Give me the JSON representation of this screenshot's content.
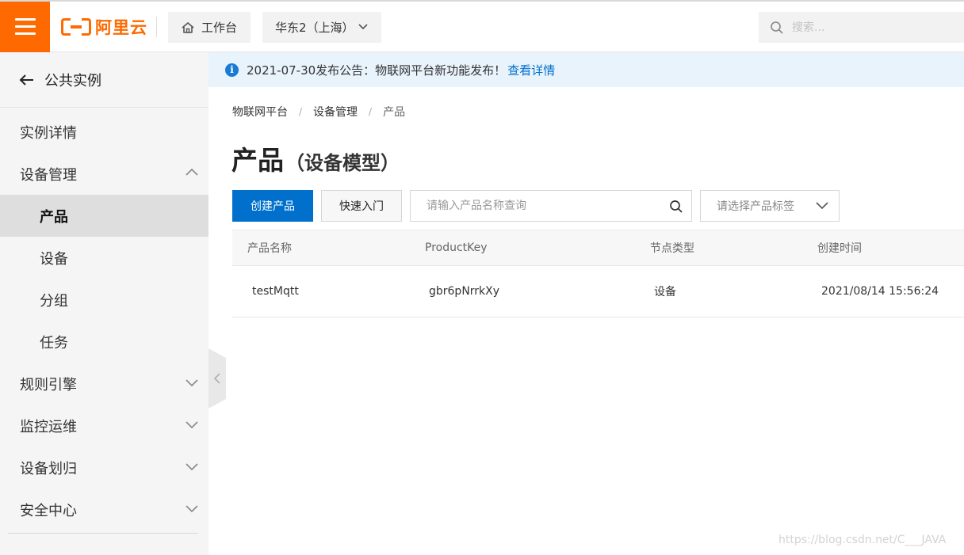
{
  "header": {
    "logo_text": "阿里云",
    "workbench_label": "工作台",
    "region_label": "华东2（上海）",
    "search_placeholder": "搜索..."
  },
  "sidebar": {
    "back_label": "公共实例",
    "items": [
      {
        "label": "实例详情",
        "level": 0
      },
      {
        "label": "设备管理",
        "level": 0,
        "expanded": true
      },
      {
        "label": "产品",
        "level": 1,
        "active": true
      },
      {
        "label": "设备",
        "level": 1
      },
      {
        "label": "分组",
        "level": 1
      },
      {
        "label": "任务",
        "level": 1
      },
      {
        "label": "规则引擎",
        "level": 0,
        "expanded": false
      },
      {
        "label": "监控运维",
        "level": 0,
        "expanded": false
      },
      {
        "label": "设备划归",
        "level": 0,
        "expanded": false
      },
      {
        "label": "安全中心",
        "level": 0,
        "expanded": false
      }
    ]
  },
  "notice": {
    "text": "2021-07-30发布公告：物联网平台新功能发布！",
    "link": "查看详情"
  },
  "breadcrumb": [
    "物联网平台",
    "设备管理",
    "产品"
  ],
  "page": {
    "title": "产品",
    "subtitle": "（设备模型）"
  },
  "toolbar": {
    "create_label": "创建产品",
    "quickstart_label": "快速入门",
    "search_placeholder": "请输入产品名称查询",
    "tag_placeholder": "请选择产品标签"
  },
  "table": {
    "columns": [
      "产品名称",
      "ProductKey",
      "节点类型",
      "创建时间"
    ],
    "rows": [
      [
        "testMqtt",
        "gbr6pNrrkXy",
        "设备",
        "2021/08/14 15:56:24"
      ]
    ]
  },
  "watermark": "https://blog.csdn.net/C___JAVA",
  "colors": {
    "brand": "#ff6a00",
    "primary": "#0070cc",
    "notice_bg": "#e8f3fc"
  }
}
